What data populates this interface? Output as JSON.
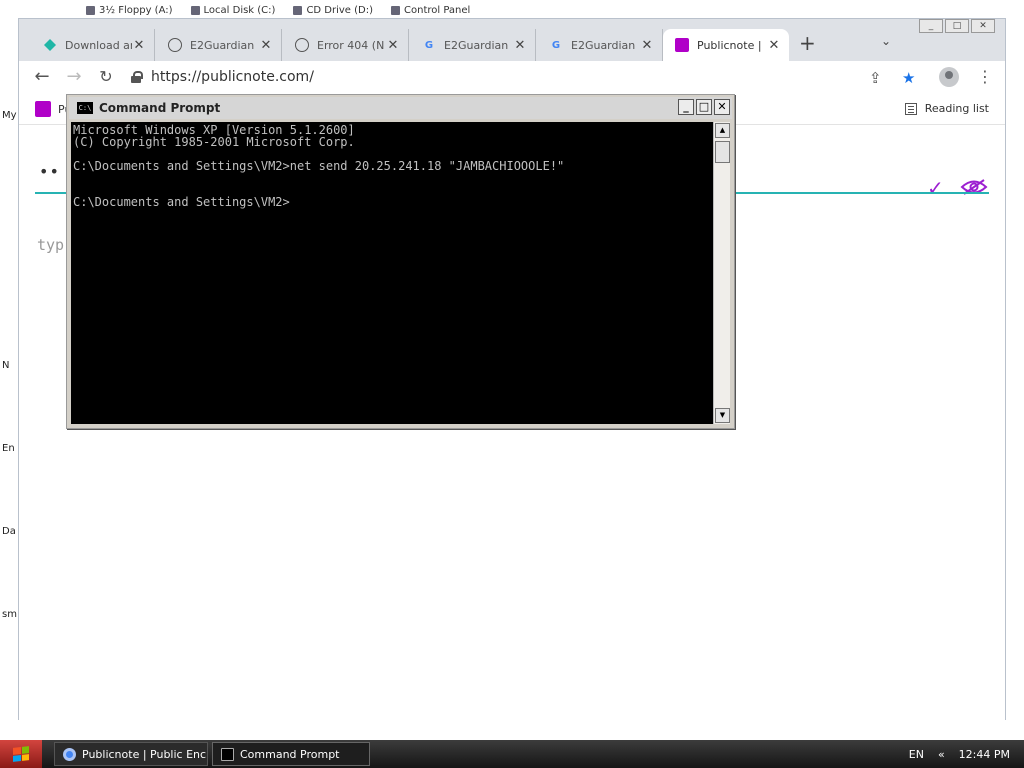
{
  "desktop": {
    "top_shortcuts": [
      "3½ Floppy (A:)",
      "Local Disk (C:)",
      "CD Drive (D:)",
      "Control Panel"
    ],
    "left_labels": [
      "My",
      "N",
      "En",
      "Da",
      "sm"
    ]
  },
  "browser": {
    "tabs": [
      {
        "title": "Download an",
        "icon": "diamond-icon",
        "color": "#1fb6a6"
      },
      {
        "title": "E2Guardian",
        "icon": "globe-icon",
        "color": "#555555"
      },
      {
        "title": "Error 404 (N",
        "icon": "globe-icon",
        "color": "#555555"
      },
      {
        "title": "E2Guardian",
        "icon": "google-icon",
        "color": "#4285f4"
      },
      {
        "title": "E2Guardian",
        "icon": "google-icon",
        "color": "#4285f4"
      },
      {
        "title": "Publicnote |",
        "icon": "publicnote-icon",
        "color": "#b000c8"
      }
    ],
    "window_buttons": [
      "_",
      "□",
      "✕"
    ],
    "url": "https://publicnote.com/",
    "bookmark_title": "Pu",
    "reading_list": "Reading list",
    "page": {
      "dots": "••",
      "placeholder": "typ"
    }
  },
  "cmd": {
    "title": "Command Prompt",
    "icon_text": "C:\\",
    "lines": [
      "Microsoft Windows XP [Version 5.1.2600]",
      "(C) Copyright 1985-2001 Microsoft Corp.",
      "",
      "C:\\Documents and Settings\\VM2>net send 20.25.241.18 \"JAMBACHIOOOLE!\"",
      "",
      "",
      "C:\\Documents and Settings\\VM2>"
    ]
  },
  "taskbar": {
    "tasks": [
      {
        "label": "Publicnote | Public Enc...",
        "icon": "chrome-icon"
      },
      {
        "label": "Command Prompt",
        "icon": "cmd-icon"
      }
    ],
    "language": "EN",
    "chevron": "«",
    "clock": "12:44 PM"
  }
}
